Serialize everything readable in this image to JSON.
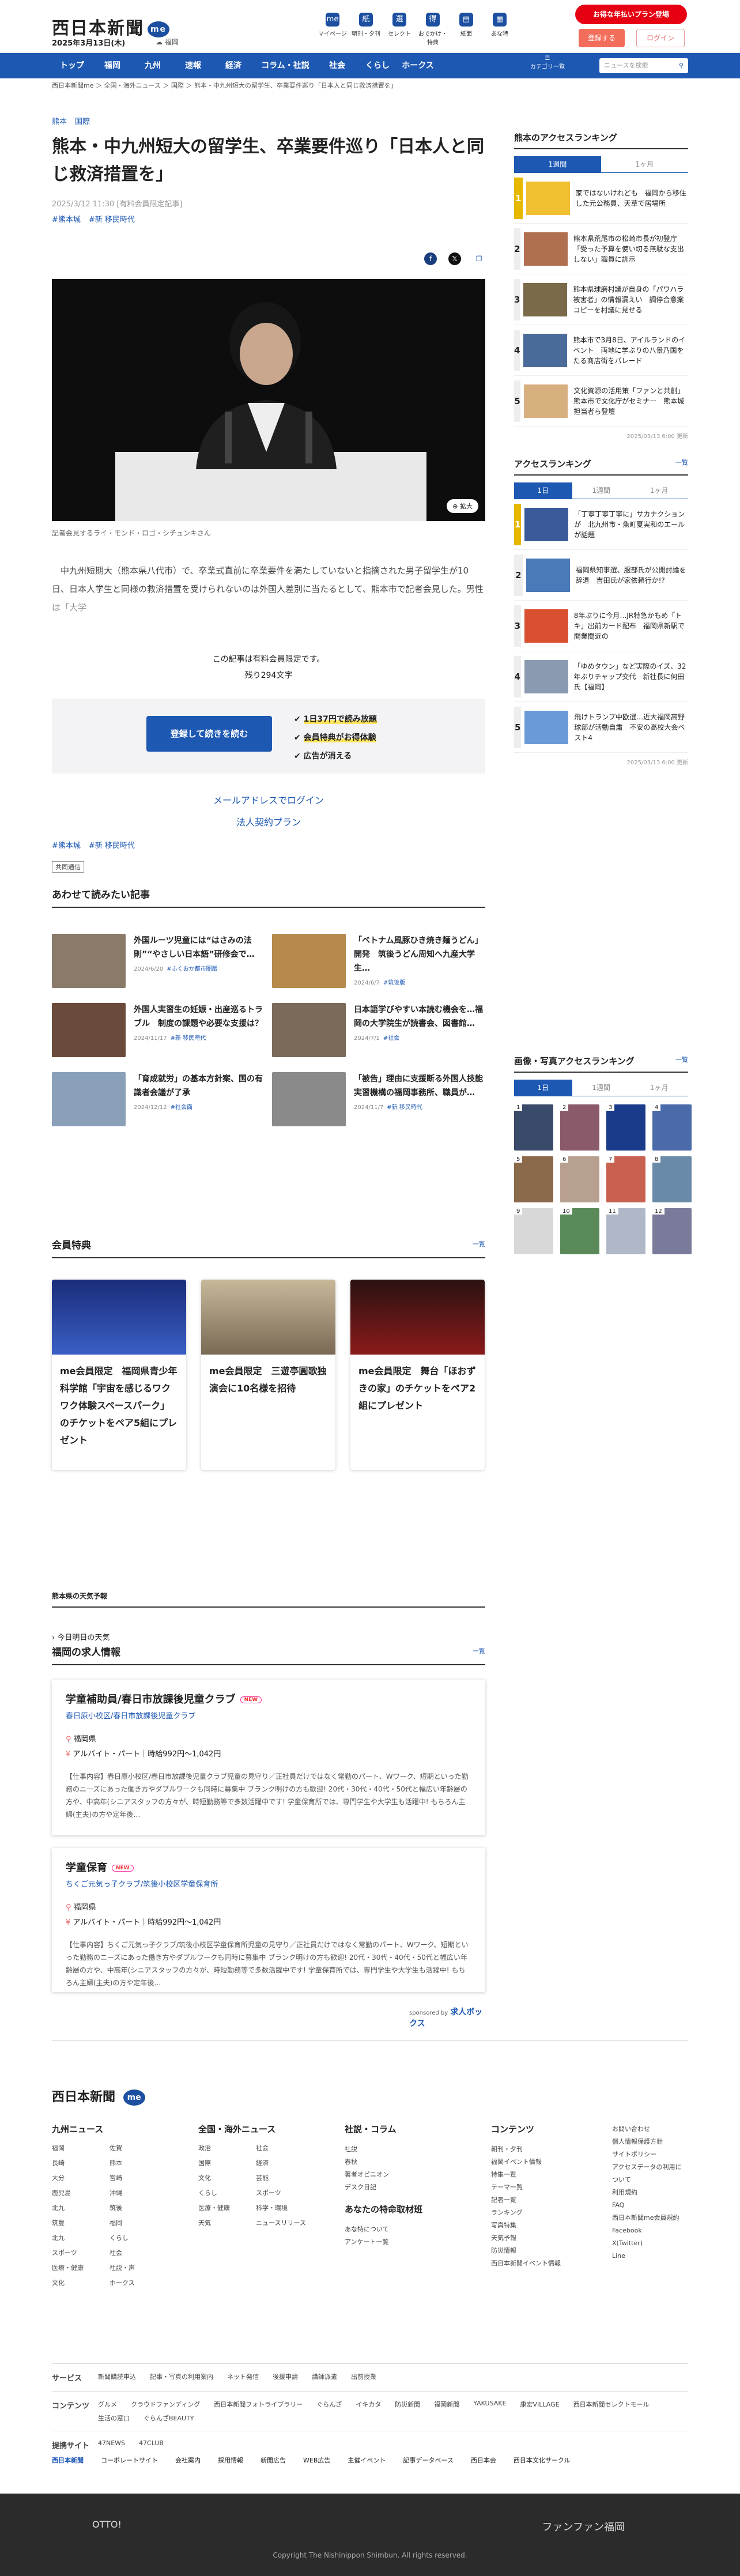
{
  "header": {
    "logo": "西日本新聞",
    "logo_badge": "me",
    "date": "2025年3月13日(木)",
    "weather_label": "福岡",
    "icons": [
      {
        "glyph": "me",
        "label": "マイページ"
      },
      {
        "glyph": "紙",
        "label": "朝刊・夕刊"
      },
      {
        "glyph": "選",
        "label": "セレクト"
      },
      {
        "glyph": "得",
        "label": "おでかけ・特典"
      },
      {
        "glyph": "▤",
        "label": "紙面"
      },
      {
        "glyph": "▦",
        "label": "あな特"
      }
    ],
    "promo": "お得な年払いプラン登場",
    "register": "登録する",
    "login": "ログイン"
  },
  "nav": {
    "items": [
      "トップ",
      "福岡",
      "九州",
      "速報",
      "経済",
      "コラム・社説",
      "社会",
      "くらし",
      "ホークス"
    ],
    "more": "カテゴリ一覧",
    "search_placeholder": "ニュースを検索"
  },
  "breadcrumb": "西日本新聞me ＞ 全国・海外ニュース ＞ 国際 ＞ 熊本・中九州短大の留学生、卒業要件巡り「日本人と同じ救済措置を」",
  "article": {
    "cats": [
      "熊本",
      "国際"
    ],
    "title": "熊本・中九州短大の留学生、卒業要件巡り「日本人と同じ救済措置を」",
    "date": "2025/3/12 11:30 [有料会員限定記事]",
    "tags": [
      "#熊本城",
      "#新 移民時代"
    ],
    "zoom": "拡大",
    "caption": "記者会見するライ・モンド・ロゴ・シチュンキさん",
    "lead": "中九州短期大（熊本県八代市）で、卒業式直前に卒業要件を満たしていないと指摘された男子留学生が10日、日本人学生と同様の救済措置を受けられないのは外国人差別に当たるとして、熊本市で記者会見した。男性は「大学",
    "paywall": "この記事は有料会員限定です。",
    "remain": "残り294文字",
    "cta": "登録して続きを読む",
    "benefits": [
      "1日37円で読み放題",
      "会員特典がお得体験",
      "広告が消える"
    ],
    "mail_login": "メールアドレスでログイン",
    "corp_plan": "法人契約プラン",
    "tags_bottom": [
      "#熊本城",
      "#新 移民時代"
    ],
    "kyodo": "共同通信"
  },
  "related": {
    "heading": "あわせて読みたい記事",
    "items": [
      {
        "title": "外国ルーツ児童には“はさみの法則”“やさしい日本語”研修会で…",
        "meta": "2024/6/20",
        "cat": "#ふくおか都市圏版"
      },
      {
        "title": "「ベトナム風豚ひき焼き麺うどん」開発　筑後うどん周知へ九産大学生…",
        "meta": "2024/6/7",
        "cat": "#筑後版"
      },
      {
        "title": "外国人実習生の妊娠・出産巡るトラブル　制度の課題や必要な支援は？",
        "meta": "2024/11/17",
        "cat": "#新 移民時代"
      },
      {
        "title": "日本語学びやすい本読む機会を…福岡の大学院生が読書会、図書館…",
        "meta": "2024/7/1",
        "cat": "#社会"
      },
      {
        "title": "「育成就労」の基本方針案、国の有識者会議が了承",
        "meta": "2024/12/12",
        "cat": "#社会面"
      },
      {
        "title": "「被告」理由に支援断る外国人技能実習機構の福岡事務所、職員が…",
        "meta": "2024/11/7",
        "cat": "#新 移民時代"
      }
    ]
  },
  "perks": {
    "heading": "会員特典",
    "more": "一覧",
    "items": [
      {
        "title": "me会員限定　福岡県青少年科学館「宇宙を感じるワクワク体験スペースパーク」のチケットをペア5組にプレゼント"
      },
      {
        "title": "me会員限定　三遊亭圓歌独演会に10名様を招待"
      },
      {
        "title": "me会員限定　舞台「ほおずきの家」のチケットをペア2組にプレゼント"
      }
    ]
  },
  "weather": {
    "heading": "熊本県の天気予報",
    "today": "今日明日の天気"
  },
  "jobs": {
    "heading": "福岡の求人情報",
    "more": "一覧",
    "items": [
      {
        "title": "学童補助員/春日市放課後児童クラブ",
        "new": "NEW",
        "company": "春日原小校区/春日市放課後児童クラブ",
        "place": "福岡県",
        "pay": "アルバイト・パート｜時給992円〜1,042円",
        "desc": "【仕事内容】春日原小校区/春日市放課後児童クラブ児童の見守り／正社員だけではなく常勤のパート、Wワーク、短期といった勤務のニーズにあった働き方やダブルワークも同時に募集中 ブランク明けの方も歓迎! 20代・30代・40代・50代と幅広い年齢層の方や、中高年(シニアスタッフの方々が、時短勤務等で多数活躍中です! 学童保育所では、専門学生や大学生も活躍中! もちろん主婦(主夫)の方や定年後…"
      },
      {
        "title": "学童保育",
        "new": "NEW",
        "company": "ちくご元気っ子クラブ/筑後小校区学童保育所",
        "place": "福岡県",
        "pay": "アルバイト・パート｜時給992円〜1,042円",
        "desc": "【仕事内容】ちくご元気っ子クラブ/筑後小校区学童保育所児童の見守り／正社員だけではなく常勤のパート、Wワーク、短期といった勤務のニーズにあった働き方やダブルワークも同時に募集中 ブランク明けの方も歓迎! 20代・30代・40代・50代と幅広い年齢層の方や、中高年(シニアスタッフの方々が、時短勤務等で多数活躍中です! 学童保育所では、専門学生や大学生も活躍中! もちろん主婦(主夫)の方や定年後…"
      }
    ],
    "sponsor": "sponsored by",
    "sponsor_name": "求人ボックス"
  },
  "side_rank1": {
    "heading": "熊本のアクセスランキング",
    "tabs": [
      "1週間",
      "1ヶ月"
    ],
    "items": [
      "家ではないけれども　福岡から移住した元公務員、天草で居場所",
      "熊本県荒尾市の松崎市長が初登庁「受った予算を使い切る無駄な支出しない」職員に訓示",
      "熊本県球磨村議が自身の「パワハラ被害者」の情報漏えい　調停合意案コピーを村議に見せる",
      "熊本市で3月8日、アイルランドのイベント　両地に学ぶりの八景乃国をたる商店街をパレード",
      "文化資源の活用策「ファンと共創」　熊本市で文化庁がセミナー　熊本城担当者ら登壇"
    ],
    "updated": "2025/03/13 6:00 更新"
  },
  "side_rank2": {
    "heading": "アクセスランキング",
    "more": "一覧",
    "tabs": [
      "1日",
      "1週間",
      "1ヶ月"
    ],
    "items": [
      "「丁寧丁寧丁寧に」サカナクションが　北九州市・魚町夏実和のエールが話題",
      "福岡県知事選、服部氏が公開討論を辞退　吉田氏が家依頼行か!?",
      "8年ぶりに今月…JR特急かもめ「トキ」出前カード配布　福岡県新駅で開業間近の",
      "「ゆめタウン」など実際のイズ、32年ぶりチャップ交代　新社長に何田氏【福岡】",
      "飛けトランプ中欧選…近大福岡高野球部が活動自粛　不安の高校大会ベスト4"
    ],
    "updated": "2025/03/13 6:00 更新"
  },
  "side_gallery": {
    "heading": "画像・写真アクセスランキング",
    "more": "一覧",
    "tabs": [
      "1日",
      "1週間",
      "1ヶ月"
    ]
  },
  "footer": {
    "logo": "西日本新聞",
    "badge": "me",
    "col1": {
      "h": "九州ニュース",
      "items": [
        "福岡",
        "佐賀",
        "長崎",
        "熊本",
        "大分",
        "宮崎",
        "鹿児島",
        "沖縄",
        "北九",
        "筑後",
        "筑豊",
        "福岡",
        "北九",
        "くらし",
        "スポーツ",
        "社会",
        "医療・健康",
        "社説・声",
        "文化",
        "ホークス"
      ]
    },
    "col2": {
      "h": "全国・海外ニュース",
      "items": [
        "政治",
        "社会",
        "国際",
        "経済",
        "文化",
        "芸能",
        "くらし",
        "スポーツ",
        "医療・健康",
        "科学・環境",
        "天気",
        "ニュースリリース"
      ]
    },
    "col3": {
      "h": "社説・コラム",
      "items": [
        "社説",
        "春秋",
        "著者オピニオン",
        "デスク日記"
      ],
      "h2": "あなたの特命取材班",
      "items2": [
        "あな特について",
        "アンケート一覧"
      ]
    },
    "col4": {
      "h": "コンテンツ",
      "items": [
        "朝刊・夕刊",
        "福岡イベント情報",
        "特集一覧",
        "テーマ一覧",
        "記者一覧",
        "ランキング",
        "写真特集",
        "天気予報",
        "防災情報",
        "西日本新聞イベント情報"
      ]
    },
    "col5": [
      "お問い合わせ",
      "個人情報保護方針",
      "サイトポリシー",
      "アクセスデータの利用について",
      "利用規約",
      "FAQ",
      "西日本新聞me会員規約",
      "Facebook",
      "X(Twitter)",
      "Line"
    ],
    "services": {
      "label": "サービス",
      "items": [
        "新聞購読申込",
        "記事・写真の利用案内",
        "ネット発信",
        "後援申請",
        "講師派遣",
        "出前授業"
      ]
    },
    "contents": {
      "label": "コンテンツ",
      "items": [
        "グルメ",
        "クラウドファンディング",
        "西日本新聞フォトライブラリー",
        "ぐらんざ",
        "イキカタ",
        "防災新聞",
        "福岡新聞",
        "YAKUSAKE",
        "康宏VILLAGE",
        "西日本新聞セレクトモール",
        "生活の窓口",
        "ぐらんざBEAUTY"
      ]
    },
    "partner": {
      "label": "提携サイト",
      "items": [
        "47NEWS",
        "47CLUB"
      ]
    },
    "corp": [
      "西日本新聞",
      "コーポレートサイト",
      "会社案内",
      "採用情報",
      "新聞広告",
      "WEB広告",
      "主催イベント",
      "記事データベース",
      "西日本会",
      "西日本文化サークル"
    ],
    "otto": "OTTO!",
    "fanfun": "ファンファン福岡",
    "copyright": "Copyright The Nishinippon Shimbun. All rights reserved."
  }
}
